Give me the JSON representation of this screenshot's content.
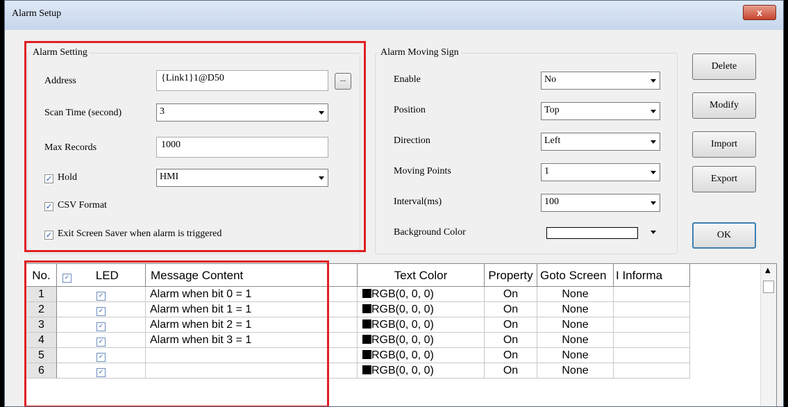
{
  "window": {
    "title": "Alarm Setup",
    "close_glyph": "x"
  },
  "alarm_setting": {
    "group_title": "Alarm Setting",
    "address_label": "Address",
    "address_value": "{Link1}1@D50",
    "browse_label": "...",
    "scan_time_label": "Scan Time (second)",
    "scan_time_value": "3",
    "max_records_label": "Max Records",
    "max_records_value": "1000",
    "hold_label": "Hold",
    "hold_checked": true,
    "hold_value": "HMI",
    "csv_label": "CSV Format",
    "csv_checked": true,
    "exit_saver_label": "Exit Screen Saver when alarm is triggered",
    "exit_saver_checked": true
  },
  "moving_sign": {
    "group_title": "Alarm Moving Sign",
    "enable_label": "Enable",
    "enable_value": "No",
    "position_label": "Position",
    "position_value": "Top",
    "direction_label": "Direction",
    "direction_value": "Left",
    "moving_points_label": "Moving Points",
    "moving_points_value": "1",
    "interval_label": "Interval(ms)",
    "interval_value": "100",
    "bg_color_label": "Background Color",
    "bg_color_value": "#ffffff"
  },
  "buttons": {
    "delete": "Delete",
    "modify": "Modify",
    "import": "Import",
    "export": "Export",
    "ok": "OK"
  },
  "table": {
    "headers": {
      "no": "No.",
      "led": "LED",
      "message": "Message Content",
      "text_color": "Text Color",
      "property": "Property",
      "goto": "Goto Screen",
      "info": "I Informa"
    },
    "rows": [
      {
        "no": "1",
        "message": "Alarm when bit 0 = 1",
        "color": "RGB(0, 0, 0)",
        "property": "On",
        "goto": "None"
      },
      {
        "no": "2",
        "message": "Alarm when bit 1 = 1",
        "color": "RGB(0, 0, 0)",
        "property": "On",
        "goto": "None"
      },
      {
        "no": "3",
        "message": "Alarm when bit 2 = 1",
        "color": "RGB(0, 0, 0)",
        "property": "On",
        "goto": "None"
      },
      {
        "no": "4",
        "message": "Alarm when bit 3 = 1",
        "color": "RGB(0, 0, 0)",
        "property": "On",
        "goto": "None"
      },
      {
        "no": "5",
        "message": "",
        "color": "RGB(0, 0, 0)",
        "property": "On",
        "goto": "None"
      },
      {
        "no": "6",
        "message": "",
        "color": "RGB(0, 0, 0)",
        "property": "On",
        "goto": "None"
      }
    ]
  },
  "colors": {
    "highlight_box": "#e01f24",
    "checkbox_check": "#2050b0"
  }
}
